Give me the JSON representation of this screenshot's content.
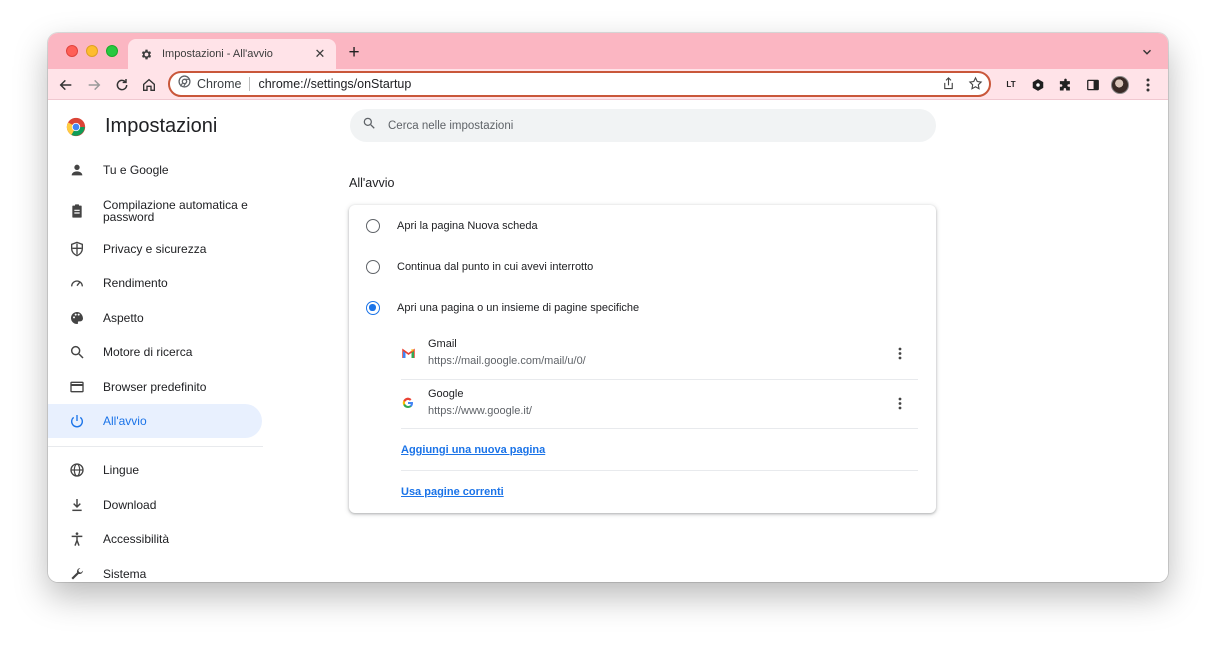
{
  "tab": {
    "title": "Impostazioni - All'avvio",
    "close": "✕"
  },
  "newtab": "+",
  "omnibox": {
    "site_name": "Chrome",
    "url": "chrome://settings/onStartup"
  },
  "extensions": {
    "lt_label": "LT"
  },
  "colors": {
    "tabstrip": "#fbb6c2",
    "toolbar": "#ffe3e8",
    "omnibox_border": "#c9573a",
    "accent": "#1a73e8"
  },
  "settings": {
    "title": "Impostazioni"
  },
  "search": {
    "placeholder": "Cerca nelle impostazioni"
  },
  "sidebar": {
    "items": [
      {
        "label": "Tu e Google",
        "icon": "person-icon"
      },
      {
        "label": "Compilazione automatica e password",
        "icon": "clipboard-icon"
      },
      {
        "label": "Privacy e sicurezza",
        "icon": "shield-icon"
      },
      {
        "label": "Rendimento",
        "icon": "speedometer-icon"
      },
      {
        "label": "Aspetto",
        "icon": "palette-icon"
      },
      {
        "label": "Motore di ricerca",
        "icon": "search-icon"
      },
      {
        "label": "Browser predefinito",
        "icon": "browser-window-icon"
      },
      {
        "label": "All'avvio",
        "icon": "power-icon",
        "active": true
      },
      {
        "label": "Lingue",
        "icon": "globe-icon"
      },
      {
        "label": "Download",
        "icon": "download-icon"
      },
      {
        "label": "Accessibilità",
        "icon": "accessibility-icon"
      },
      {
        "label": "Sistema",
        "icon": "wrench-icon"
      }
    ]
  },
  "startup": {
    "section_title": "All'avvio",
    "options": [
      {
        "label": "Apri la pagina Nuova scheda",
        "checked": false
      },
      {
        "label": "Continua dal punto in cui avevi interrotto",
        "checked": false
      },
      {
        "label": "Apri una pagina o un insieme di pagine specifiche",
        "checked": true
      }
    ],
    "pages": [
      {
        "name": "Gmail",
        "url": "https://mail.google.com/mail/u/0/",
        "icon": "gmail-icon"
      },
      {
        "name": "Google",
        "url": "https://www.google.it/",
        "icon": "google-icon"
      }
    ],
    "add_page": "Aggiungi una nuova pagina",
    "use_current": "Usa pagine correnti"
  }
}
